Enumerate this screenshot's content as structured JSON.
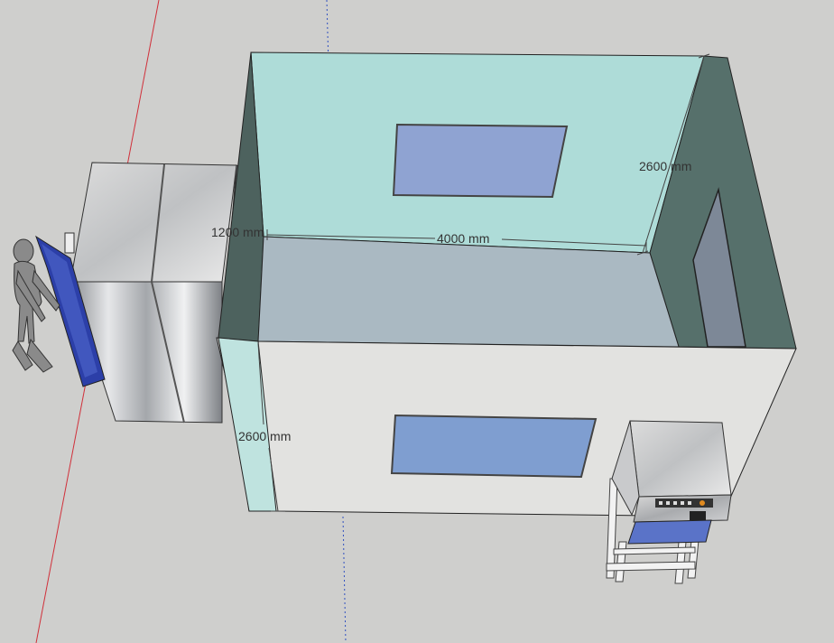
{
  "dimensions": {
    "top_height": "2600 mm",
    "room_length": "4000 mm",
    "ante_length": "1200 mm",
    "front_height": "2600 mm"
  },
  "colors": {
    "background": "#cfcfcd",
    "back_wall": "#aedcd8",
    "right_wall": "#56706b",
    "floor": "#aab9c2",
    "front_wall": "#e2e2e0",
    "window": "#8fa3d2",
    "door": "#7d8897",
    "red_axis": "#d0303a",
    "blue_axis": "#3050c0"
  },
  "objects": [
    "human-figure",
    "air-shower-unit",
    "clean-room",
    "pass-box-on-stand"
  ]
}
